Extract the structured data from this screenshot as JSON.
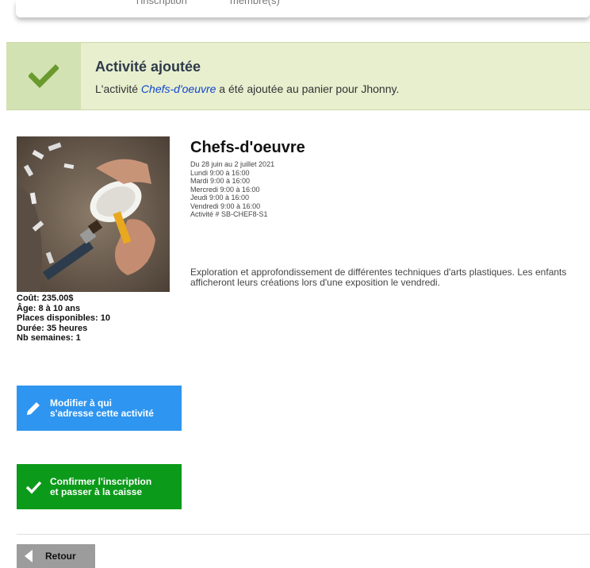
{
  "top_tabs": [
    {
      "label": "l'inscription"
    },
    {
      "label": "membre(s)"
    }
  ],
  "banner": {
    "title": "Activité ajoutée",
    "message_prefix": "L'activité ",
    "activity_link": "Chefs-d'oeuvre",
    "message_suffix": " a été ajoutée au panier pour Jhonny.",
    "accent_color": "#6a9a2e"
  },
  "activity": {
    "title": "Chefs-d'oeuvre",
    "schedule": [
      "Du 28 juin au 2 juillet 2021",
      "Lundi 9:00 à 16:00",
      "Mardi 9:00 à 16:00",
      "Mercredi 9:00 à 16:00",
      "Jeudi 9:00 à 16:00",
      "Vendredi 9:00 à 16:00",
      "Activité # SB-CHEF8-S1"
    ],
    "description": "Exploration et approfondissement de différentes techniques d'arts plastiques. Les enfants afficheront leurs créations lors d'une exposition le vendredi.",
    "details": [
      "Coût: 235.00$",
      "Âge: 8 à 10 ans",
      "Places disponibles: 10",
      "Durée: 35 heures",
      "Nb semaines: 1"
    ]
  },
  "buttons": {
    "modify": {
      "line1": "Modifier à qui",
      "line2": "s'adresse cette activité",
      "color": "#2e95f0"
    },
    "confirm": {
      "line1": "Confirmer l'inscription",
      "line2": "et passer à la caisse",
      "color": "#0c9a1a"
    },
    "back": {
      "label": "Retour"
    }
  }
}
